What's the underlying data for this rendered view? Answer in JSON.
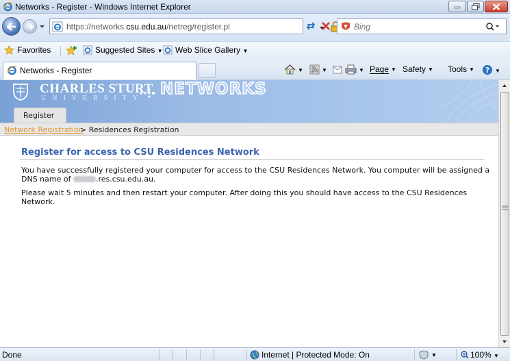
{
  "window": {
    "title": "Networks - Register - Windows Internet Explorer"
  },
  "address": {
    "url_prefix": "https://networks.",
    "url_domain": "csu.edu.au",
    "url_path": "/netreg/register.pl"
  },
  "search": {
    "placeholder": "Bing"
  },
  "favorites_bar": {
    "favorites_label": "Favorites",
    "suggested_label": "Suggested Sites",
    "slice_label": "Web Slice Gallery"
  },
  "tab": {
    "label": "Networks - Register"
  },
  "commands": {
    "page": "Page",
    "safety": "Safety",
    "tools": "Tools"
  },
  "site": {
    "uni_name": "CHARLES STURT",
    "uni_sub": "UNIVERSITY",
    "section": "NETWORKS",
    "nav_tab": "Register"
  },
  "breadcrumb": {
    "link": "Network Registration",
    "current": "> Residences Registration"
  },
  "content": {
    "heading": "Register for access to CSU Residences Network",
    "p1_start": "You have successfully registered your computer for access to the CSU Residences Network. You computer will be assigned a DNS name of",
    "p1_end": ".res.csu.edu.au.",
    "p2": "Please wait 5 minutes and then restart your computer. After doing this you should have access to the CSU Residences Network."
  },
  "status": {
    "text": "Done",
    "zone": "Internet | Protected Mode: On",
    "zoom": "100%"
  },
  "colors": {
    "heading": "#3b64ae",
    "link": "#e0932f",
    "banner": "#9cbce6"
  }
}
